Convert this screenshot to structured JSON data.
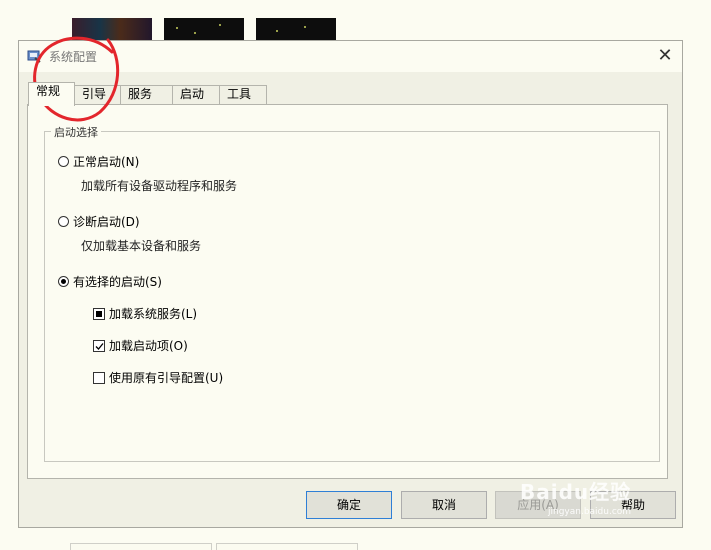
{
  "window": {
    "title": "系统配置",
    "close_glyph": "✕"
  },
  "tabs": [
    {
      "label": "常规",
      "active": true
    },
    {
      "label": "引导"
    },
    {
      "label": "服务"
    },
    {
      "label": "启动"
    },
    {
      "label": "工具"
    }
  ],
  "startup_group": {
    "legend": "启动选择",
    "normal": {
      "label": "正常启动(N)",
      "desc": "加载所有设备驱动程序和服务",
      "selected": false
    },
    "diagnostic": {
      "label": "诊断启动(D)",
      "desc": "仅加载基本设备和服务",
      "selected": false
    },
    "selective": {
      "label": "有选择的启动(S)",
      "selected": true,
      "options": [
        {
          "label": "加载系统服务(L)",
          "state": "indeterminate"
        },
        {
          "label": "加载启动项(O)",
          "state": "checked"
        },
        {
          "label": "使用原有引导配置(U)",
          "state": "unchecked"
        }
      ]
    }
  },
  "buttons": {
    "ok": "确定",
    "cancel": "取消",
    "apply": "应用(A)",
    "help": "帮助"
  },
  "watermark": {
    "text": "Baidu经验",
    "sub": "jingyan.baidu.com"
  },
  "colors": {
    "annotation_red": "#e3262c",
    "primary_border": "#2f7fd6",
    "dialog_bg": "#f0f0e4"
  }
}
